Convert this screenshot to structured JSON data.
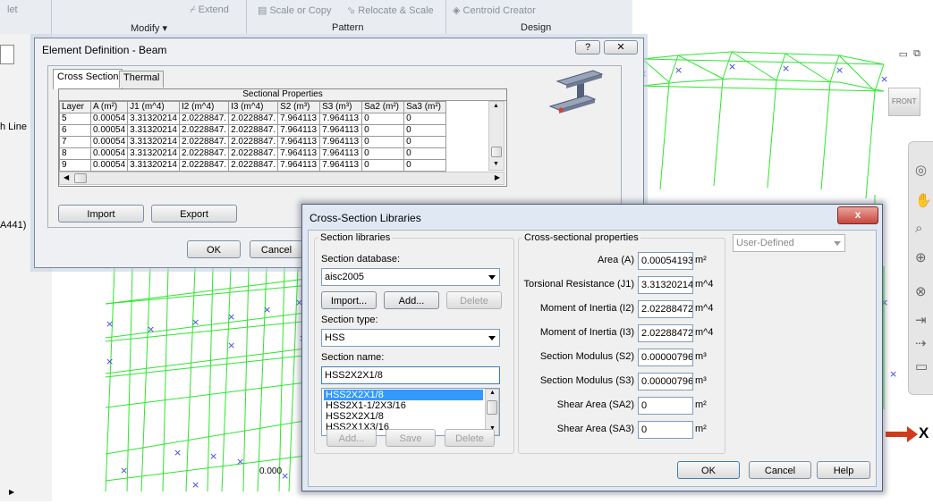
{
  "ribbon": {
    "left_cut": "let",
    "extend": "Extend",
    "scale_or_copy": "Scale or Copy",
    "relocate_scale": "Relocate & Scale",
    "centroid_creator": "Centroid Creator",
    "group_modify": "Modify ▾",
    "group_pattern": "Pattern",
    "group_design": "Design"
  },
  "left_pane": {
    "text1": "h Line",
    "text2": "A441)"
  },
  "viewport": {
    "viewcube_face": "FRONT",
    "coord_label": "0.000"
  },
  "beam_dialog": {
    "title": "Element Definition - Beam",
    "help_btn": "?",
    "close_btn": "✕",
    "tabs": [
      "Cross Section",
      "Thermal"
    ],
    "table_title": "Sectional Properties",
    "columns": [
      "Layer",
      "A (m²)",
      "J1 (m^4)",
      "I2 (m^4)",
      "I3 (m^4)",
      "S2 (m³)",
      "S3 (m³)",
      "Sa2 (m²)",
      "Sa3 (m²)"
    ],
    "rows": [
      [
        "5",
        "0.00054",
        "3.31320214",
        "2.0228847.",
        "2.0228847.",
        "7.964113",
        "7.964113",
        "0",
        "0"
      ],
      [
        "6",
        "0.00054",
        "3.31320214",
        "2.0228847.",
        "2.0228847.",
        "7.964113",
        "7.964113",
        "0",
        "0"
      ],
      [
        "7",
        "0.00054",
        "3.31320214",
        "2.0228847.",
        "2.0228847.",
        "7.964113",
        "7.964113",
        "0",
        "0"
      ],
      [
        "8",
        "0.00054",
        "3.31320214",
        "2.0228847.",
        "2.0228847.",
        "7.964113",
        "7.964113",
        "0",
        "0"
      ],
      [
        "9",
        "0.00054",
        "3.31320214",
        "2.0228847.",
        "2.0228847.",
        "7.964113",
        "7.964113",
        "0",
        "0"
      ]
    ],
    "import_btn": "Import",
    "export_btn": "Export",
    "ok_btn": "OK",
    "cancel_btn": "Cancel"
  },
  "lib_dialog": {
    "title": "Cross-Section Libraries",
    "close_btn": "x",
    "section_libraries": "Section libraries",
    "section_database_label": "Section database:",
    "section_database_value": "aisc2005",
    "import_btn": "Import...",
    "add_btn": "Add...",
    "delete_btn": "Delete",
    "section_type_label": "Section type:",
    "section_type_value": "HSS",
    "section_name_label": "Section name:",
    "section_name_value": "HSS2X2X1/8",
    "list_items": [
      "HSS2X2X1/8",
      "HSS2X1-1/2X3/16",
      "HSS2X2X1/8",
      "HSS2X1X3/16"
    ],
    "list_selected_index": 0,
    "add2_btn": "Add...",
    "save_btn": "Save",
    "delete2_btn": "Delete",
    "props_title": "Cross-sectional properties",
    "user_defined": "User-Defined",
    "props": [
      {
        "label": "Area (A)",
        "value": "0.000541934",
        "unit": "m²"
      },
      {
        "label": "Torsional Resistance (J1)",
        "value": "3.313202147",
        "unit": "m^4"
      },
      {
        "label": "Moment of Inertia (I2)",
        "value": "2.022884728",
        "unit": "m^4"
      },
      {
        "label": "Moment of Inertia (I3)",
        "value": "2.022884728",
        "unit": "m^4"
      },
      {
        "label": "Section Modulus (S2)",
        "value": "0.000007964",
        "unit": "m³"
      },
      {
        "label": "Section Modulus (S3)",
        "value": "0.000007964",
        "unit": "m³"
      },
      {
        "label": "Shear Area (SA2)",
        "value": "0",
        "unit": "m²"
      },
      {
        "label": "Shear Area (SA3)",
        "value": "0",
        "unit": "m²"
      }
    ],
    "ok_btn": "OK",
    "cancel_btn": "Cancel",
    "help_btn": "Help"
  },
  "colors": {
    "wireframe": "#2ee52e",
    "node_marker": "#3a4bd8",
    "axis_red": "#d23a1a",
    "selection": "#3399ff",
    "close_red": "#c9463d"
  }
}
